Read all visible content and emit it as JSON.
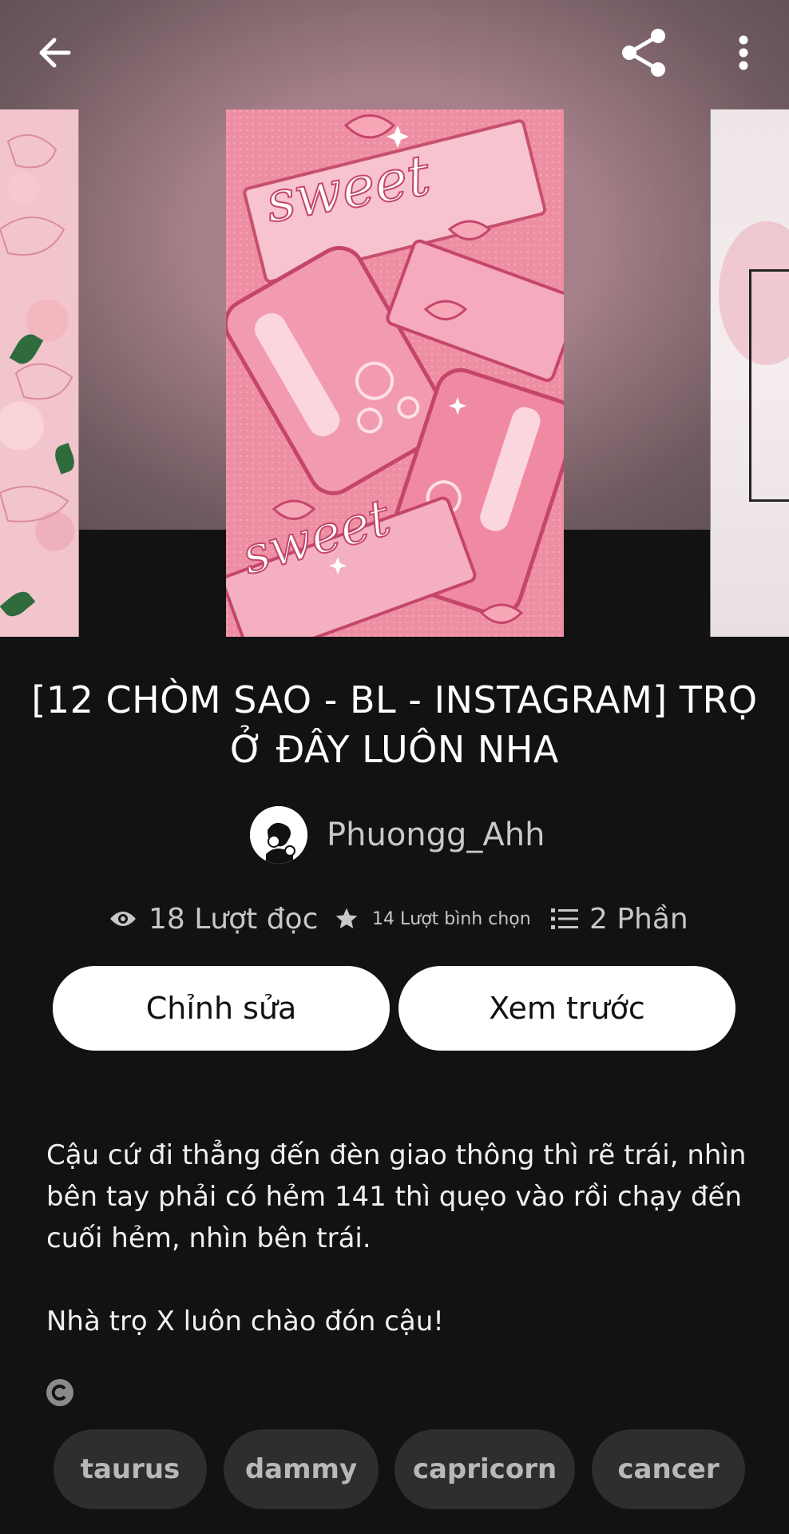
{
  "header": {
    "back_icon": "arrow-left-icon",
    "share_icon": "share-icon",
    "more_icon": "more-vertical-icon"
  },
  "covers": {
    "main_text_top": "sweet",
    "main_text_bottom": "sweet"
  },
  "story": {
    "title": "[12 CHÒM SAO - BL - INSTAGRAM] TRỌ Ở ĐÂY LUÔN NHA",
    "author": "Phuongg_Ahh"
  },
  "stats": {
    "reads": "18 Lượt đọc",
    "votes": "14 Lượt bình chọn",
    "parts": "2 Phần"
  },
  "actions": {
    "edit_label": "Chỉnh sửa",
    "preview_label": "Xem trước"
  },
  "description": {
    "paragraph1": "Cậu cứ đi thẳng đến đèn giao thông thì rẽ trái, nhìn bên tay phải có hẻm 141 thì quẹo vào rồi chạy đến cuối hẻm, nhìn bên trái.",
    "paragraph2": "Nhà trọ X luôn chào đón cậu!"
  },
  "copyright_icon": "copyright-icon",
  "tags": [
    "taurus",
    "dammy",
    "capricorn",
    "cancer"
  ]
}
